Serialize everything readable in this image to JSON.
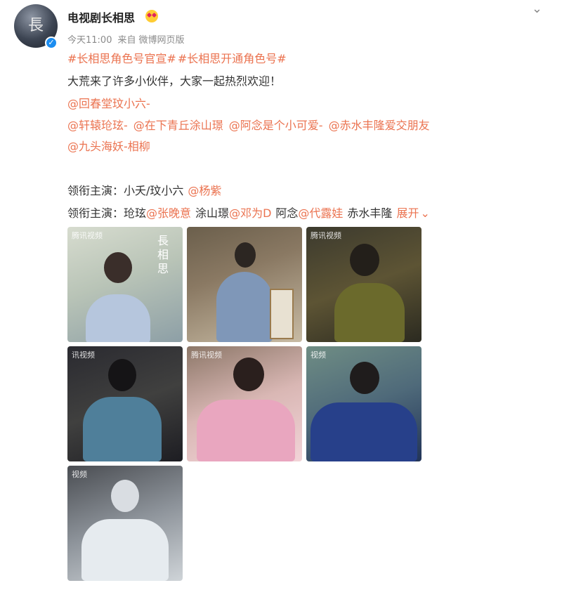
{
  "post": {
    "author": "电视剧长相思",
    "author_emoji": "heart-eyes-emoji",
    "avatar_glyph": "長",
    "verified_icon": "verified-badge-icon",
    "menu_icon": "chevron-down-icon",
    "meta": {
      "time": "今天11:00",
      "source_prefix": "来自",
      "source": "微博网页版"
    },
    "hashtags": [
      "#长相思角色号官宣#",
      "#长相思开通角色号#"
    ],
    "intro": "大荒来了许多小伙伴，大家一起热烈欢迎！",
    "mention_line1": [
      "@回春堂玟小六-"
    ],
    "mention_line2": [
      "@轩辕玱玹-",
      "@在下青丘涂山璟",
      "@阿念是个小可爱-",
      "@赤水丰隆爱交朋友"
    ],
    "mention_line3": [
      "@九头海妖-相柳"
    ],
    "lead1": {
      "label": "领衔主演：",
      "role": "小夭/玟小六",
      "actor": "@杨紫"
    },
    "lead2": {
      "label": "领衔主演：",
      "role1": "玱玹",
      "actor1": "@张晚意",
      "role2": "涂山璟",
      "actor2": "@邓为D",
      "role3": "阿念",
      "actor3": "@代露娃",
      "role4": "赤水丰隆",
      "expand": "展开",
      "expand_icon": "chevron-down-icon"
    },
    "images": [
      {
        "name": "still-xiaoyao",
        "watermark": "腾讯视频",
        "overlay_text": "長相思"
      },
      {
        "name": "still-xiaoliu-market",
        "watermark": ""
      },
      {
        "name": "still-xuanxuan",
        "watermark": "腾讯视频"
      },
      {
        "name": "still-jing",
        "watermark": "讯视频"
      },
      {
        "name": "still-anian",
        "watermark": "腾讯视频"
      },
      {
        "name": "still-fenglong",
        "watermark": "视频"
      },
      {
        "name": "still-xiangliu",
        "watermark": "视频"
      }
    ],
    "colors": {
      "link": "#eb7350",
      "text": "#333333",
      "meta": "#8a8a8a",
      "verified": "#1c8df0"
    }
  }
}
